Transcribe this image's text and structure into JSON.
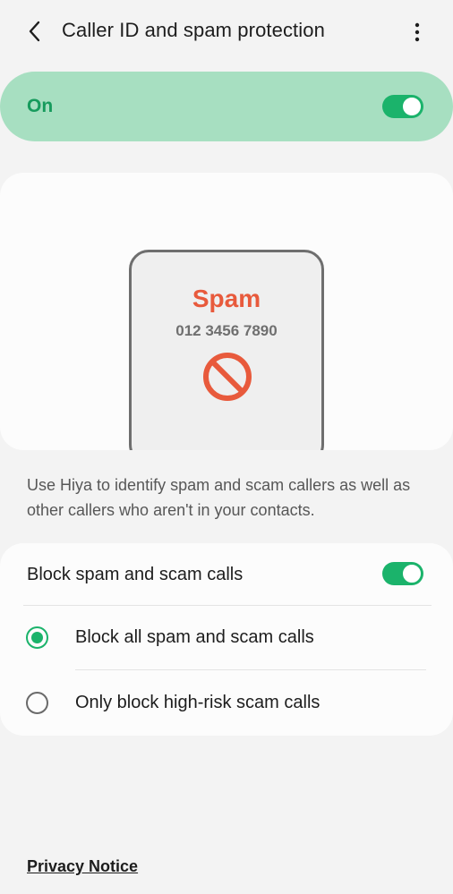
{
  "header": {
    "title": "Caller ID and spam protection",
    "back_icon": "chevron-left-icon",
    "more_icon": "more-vertical-icon"
  },
  "master_switch": {
    "label": "On",
    "state": true
  },
  "illustration": {
    "caller_label": "Spam",
    "phone_number": "012 3456 7890",
    "icon": "block-icon"
  },
  "description": "Use Hiya to identify spam and scam callers as well as other callers who aren't in your contacts.",
  "block_settings": {
    "title": "Block spam and scam calls",
    "toggle_state": true,
    "options": [
      {
        "label": "Block all spam and scam calls",
        "selected": true
      },
      {
        "label": "Only block high-risk scam calls",
        "selected": false
      }
    ]
  },
  "footer": {
    "privacy_link": "Privacy Notice"
  },
  "colors": {
    "accent": "#1bb36b",
    "master_bg": "#a7dfc1",
    "master_text": "#179b5d",
    "spam_red": "#e85a3c",
    "background": "#f3f3f3",
    "card": "#fcfcfc"
  }
}
